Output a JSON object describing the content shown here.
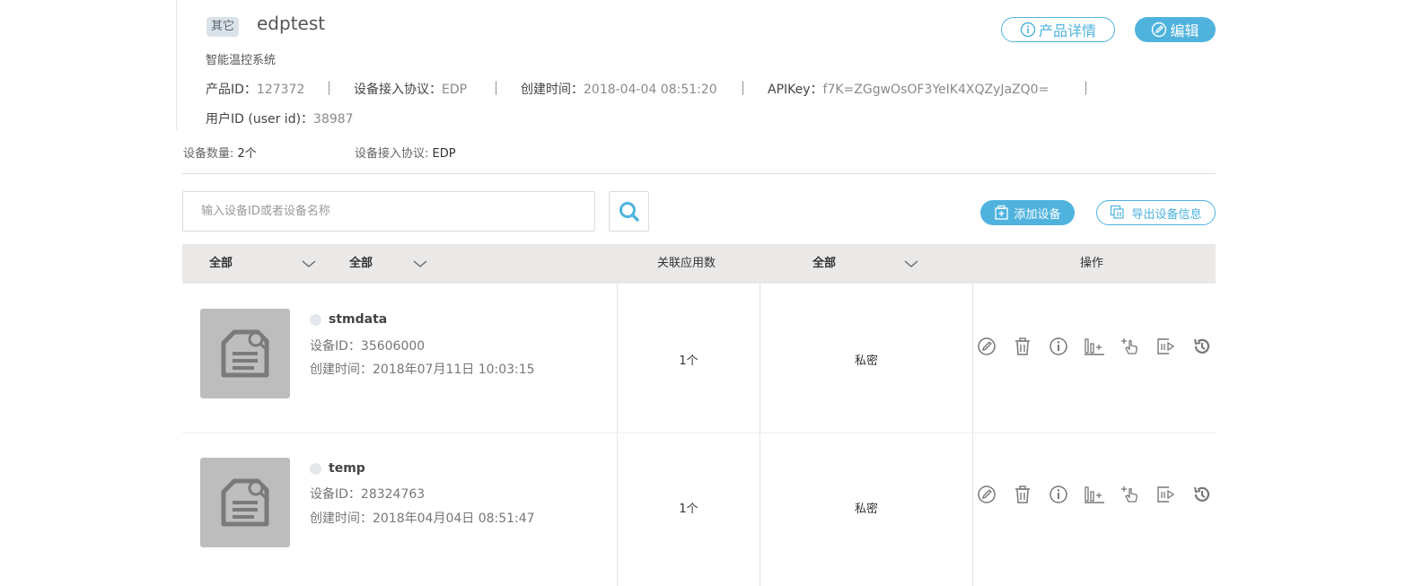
{
  "product": {
    "tag": "其它",
    "name": "edptest",
    "description": "智能温控系统",
    "meta": [
      {
        "label": "产品ID：",
        "value": "127372"
      },
      {
        "label": "设备接入协议：",
        "value": "EDP"
      },
      {
        "label": "创建时间：",
        "value": "2018-04-04 08:51:20"
      },
      {
        "label": "APIKey：",
        "value": "f7K=ZGgwOsOF3YeIK4XQZyJaZQ0="
      }
    ],
    "separator": "|",
    "user_label": "用户ID (user id)：",
    "user_value": "38987",
    "detail_button": "产品详情",
    "edit_button": "编辑"
  },
  "stats": {
    "count_label": "设备数量:",
    "count_value": "2个",
    "protocol_label": "设备接入协议:",
    "protocol_value": "EDP"
  },
  "search": {
    "placeholder": "输入设备ID或者设备名称"
  },
  "actions": {
    "add_device": "添加设备",
    "export": "导出设备信息"
  },
  "table": {
    "headers": {
      "filter1": "全部",
      "filter2": "全部",
      "app_count": "关联应用数",
      "filter3": "全部",
      "operations": "操作"
    },
    "rows": [
      {
        "name": "stmdata",
        "id_label": "设备ID：",
        "id": "35606000",
        "created_label": "创建时间：",
        "created": "2018年07月11日 10:03:15",
        "apps": "1个",
        "privacy": "私密"
      },
      {
        "name": "temp",
        "id_label": "设备ID：",
        "id": "28324763",
        "created_label": "创建时间：",
        "created": "2018年04月04日 08:51:47",
        "apps": "1个",
        "privacy": "私密"
      }
    ],
    "op_icons": [
      "edit-icon",
      "delete-icon",
      "info-icon",
      "datastream-icon",
      "command-icon",
      "export-icon",
      "history-icon"
    ]
  },
  "colors": {
    "accent": "#4fb3de",
    "header_bg": "#ebe9e8",
    "thumb_bg": "#bdbdbd"
  }
}
